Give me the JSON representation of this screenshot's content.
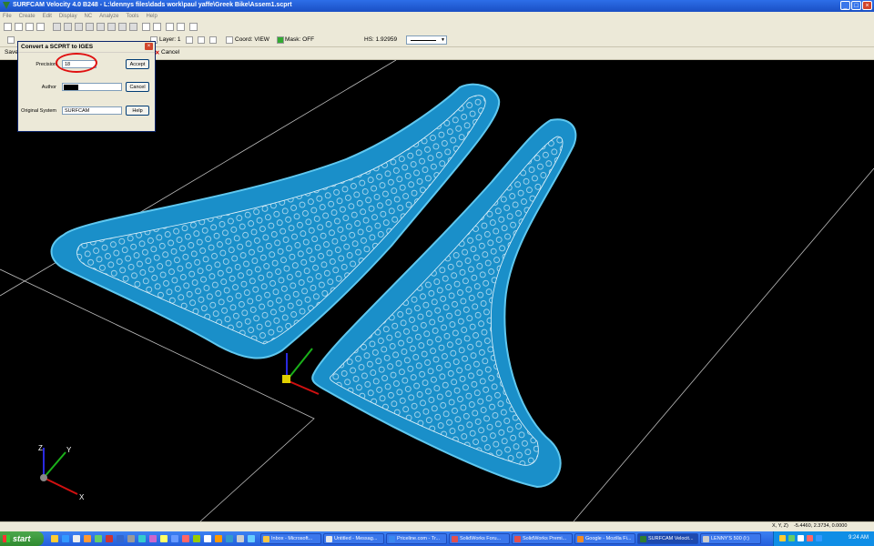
{
  "window": {
    "title": "SURFCAM Velocity 4.0 B248 - L:\\dennys files\\dads work\\paul yaffe\\Greek Bike\\Assem1.scprt",
    "controls": [
      "_",
      "□",
      "×"
    ]
  },
  "menu": [
    "File",
    "Create",
    "Edit",
    "Display",
    "NC",
    "Analyze",
    "Tools",
    "Help"
  ],
  "toolbar2": {
    "layer_label": "Layer: 1",
    "coord_label": "Coord: VIEW",
    "mask_label": "Mask: OFF",
    "hs_label": "HS: 1.92959"
  },
  "toolbar3": {
    "save_label": "Save",
    "cancel_label": "Cancel"
  },
  "dialog": {
    "title": "Convert a SCPRT to IGES",
    "precision_label": "Precision",
    "precision_value": "18",
    "author_label": "Author",
    "author_value": "",
    "system_label": "Original System",
    "system_value": "SURFCAM",
    "accept": "Accept",
    "cancel": "Cancel",
    "help": "Help"
  },
  "axis_labels": {
    "x": "X",
    "y": "Y",
    "z": "Z"
  },
  "status": {
    "coord_label": "X, Y, Z)",
    "coord_value": "-5.4460, 2.3734, 0.0000"
  },
  "taskbar": {
    "start": "start",
    "tasks": [
      "Inbox - Microsoft...",
      "Untitled - Messag...",
      "Priceline.com - Tr...",
      "SolidWorks Foru...",
      "SolidWorks Premi...",
      "Google - Mozilla Fi...",
      "SURFCAM Velocit...",
      "LENNY'S 500 (I:)"
    ],
    "clock": "9:24 AM"
  },
  "colors": {
    "part_fill": "#1a8fc9",
    "part_edge": "#5fc8f0",
    "background": "#000000",
    "highlight": "#e01010"
  }
}
